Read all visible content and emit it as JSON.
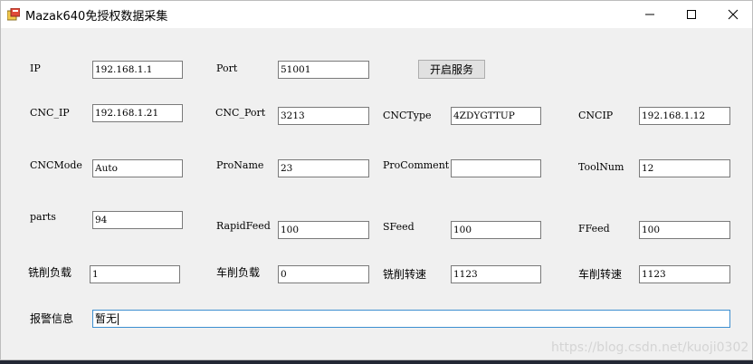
{
  "window": {
    "title": "Mazak640免授权数据采集"
  },
  "row1": {
    "ip_label": "IP",
    "ip_value": "192.168.1.1",
    "port_label": "Port",
    "port_value": "51001",
    "start_button": "开启服务"
  },
  "row2": {
    "cnc_ip_label": "CNC_IP",
    "cnc_ip_value": "192.168.1.21",
    "cnc_port_label": "CNC_Port",
    "cnc_port_value": "3213",
    "cnc_type_label": "CNCType",
    "cnc_type_value": "4ZDYGTTUP",
    "cncip_label": "CNCIP",
    "cncip_value": "192.168.1.12"
  },
  "row3": {
    "cnc_mode_label": "CNCMode",
    "cnc_mode_value": "Auto",
    "pro_name_label": "ProName",
    "pro_name_value": "23",
    "pro_comment_label": "ProComment",
    "pro_comment_value": "",
    "tool_num_label": "ToolNum",
    "tool_num_value": "12"
  },
  "row4": {
    "parts_label": "parts",
    "parts_value": "94",
    "rapid_feed_label": "RapidFeed",
    "rapid_feed_value": "100",
    "sfeed_label": "SFeed",
    "sfeed_value": "100",
    "ffeed_label": "FFeed",
    "ffeed_value": "100"
  },
  "row5": {
    "mill_load_label": "铣削负载",
    "mill_load_value": "1",
    "turn_load_label": "车削负载",
    "turn_load_value": "0",
    "mill_speed_label": "铣削转速",
    "mill_speed_value": "1123",
    "turn_speed_label": "车削转速",
    "turn_speed_value": "1123"
  },
  "alarm": {
    "label": "报警信息",
    "value": "暂无"
  },
  "watermark": "https://blog.csdn.net/kuoji0302"
}
